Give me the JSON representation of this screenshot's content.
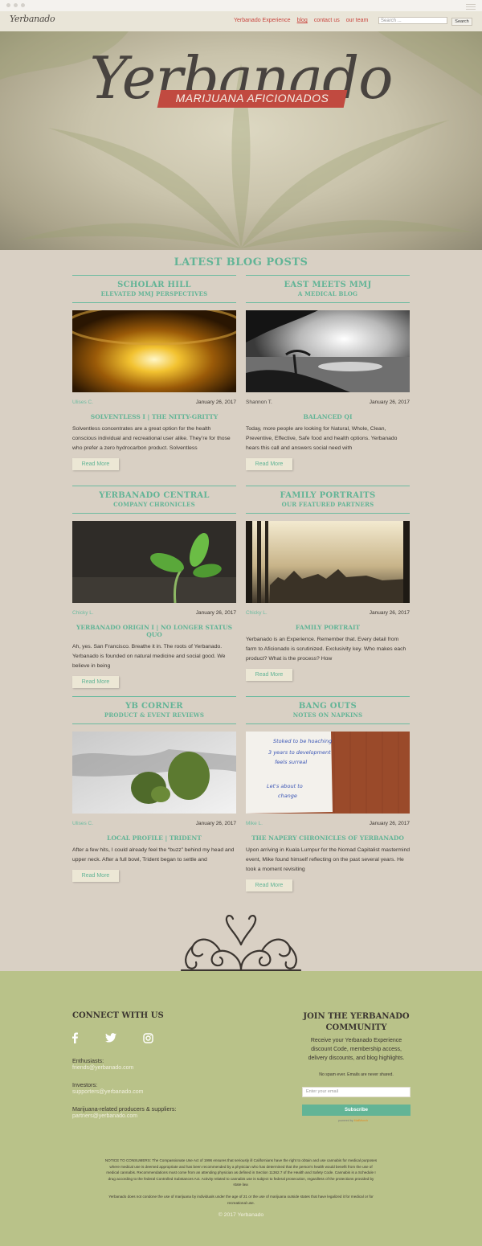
{
  "nav": {
    "logo": "Yerbanado",
    "links": [
      "Yerbanado Experience",
      "blog",
      "contact us",
      "our team"
    ],
    "active_link": "blog",
    "search_placeholder": "Search ...",
    "search_button": "Search"
  },
  "hero": {
    "title": "Yerbanado",
    "tagline": "MARIJUANA AFICIONADOS"
  },
  "latest": {
    "title": "LATEST BLOG POSTS"
  },
  "posts": [
    {
      "category": "SCHOLAR HILL",
      "subcategory": "ELEVATED MMJ PERSPECTIVES",
      "image": "amber-concentrate-jar",
      "author": "Ulises C.",
      "date": "January 26, 2017",
      "title": "SOLVENTLESS I | THE NITTY-GRITTY",
      "excerpt": "Solventless concentrates are a great option for the health conscious individual and recreational user alike. They’re for those who prefer a zero hydrocarbon product. Solventless",
      "read_more": "Read More"
    },
    {
      "category": "EAST MEETS MMJ",
      "subcategory": "A MEDICAL BLOG",
      "image": "lake-sunset-silhouette",
      "author": "Shannon T.",
      "date": "January 26, 2017",
      "title": "BALANCED QI",
      "excerpt": "Today, more people are looking for Natural, Whole, Clean, Preventive, Effective, Safe food and health options. Yerbanado hears this call and answers social need with",
      "read_more": "Read More"
    },
    {
      "category": "YERBANADO CENTRAL",
      "subcategory": "COMPANY CHRONICLES",
      "image": "seedling-sprout",
      "author": "Chicky L.",
      "date": "January 26, 2017",
      "title": "YERBANADO ORIGIN I | NO LONGER STATUS QUO",
      "excerpt": "Ah, yes. San Francisco. Breathe it in. The roots of Yerbanado. Yerbanado is founded on natural medicine and social good. We believe in being",
      "read_more": "Read More"
    },
    {
      "category": "FAMILY PORTRAITS",
      "subcategory": "OUR FEATURED PARTNERS",
      "image": "city-skyline-window",
      "author": "Chicky L.",
      "date": "January 26, 2017",
      "title": "FAMILY PORTRAIT",
      "excerpt": "Yerbanado is an Experience. Remember that. Every detail from farm to Aficionado is scrutinized. Exclusivity key. Who makes each product? What is the process? How",
      "read_more": "Read More"
    },
    {
      "category": "YB CORNER",
      "subcategory": "PRODUCT & EVENT REVIEWS",
      "image": "cannabis-buds",
      "author": "Ulises C.",
      "date": "January 26, 2017",
      "title": "LOCAL PROFILE | TRIDENT",
      "excerpt": "After a few hits, I could already feel the “buzz” behind my head and upper neck. After a full bowl, Trident began to settle and",
      "read_more": "Read More"
    },
    {
      "category": "BANG OUTS",
      "subcategory": "NOTES ON NAPKINS",
      "image": "handwritten-napkin",
      "author": "Mike L.",
      "date": "January 26, 2017",
      "title": "THE NAPERY CHRONICLES OF YERBANADO",
      "excerpt": "Upon arriving in Kuala Lumpur for the Nomad Capitalist mastermind event, Mike found himself reflecting on the past several years. He took a moment revisiting",
      "read_more": "Read More"
    }
  ],
  "napkin_lines": [
    "Stoked to be hoaching",
    "3 years to development",
    "feels surreal",
    "Let's about to",
    "change"
  ],
  "footer": {
    "connect_title": "CONNECT WITH US",
    "social_icons": [
      "facebook-icon",
      "twitter-icon",
      "instagram-icon"
    ],
    "contacts": [
      {
        "label": "Enthusiasts:",
        "email": "friends@yerbanado.com"
      },
      {
        "label": "Investors:",
        "email": "supporters@yerbanado.com"
      },
      {
        "label": "Marijuana-related producers & suppliers:",
        "email": "partners@yerbanado.com"
      }
    ],
    "join_title": "JOIN THE YERBANADO COMMUNITY",
    "join_desc": "Receive your Yerbanado Experience discount Code, membership access, delivery discounts, and blog highlights.",
    "no_spam": "No spam ever. Emails are never shared.",
    "email_placeholder": "Enter your email",
    "subscribe": "Subscribe",
    "powered_by": "powered by",
    "powered_brand": "MailMunch",
    "notice": "NOTICE TO CONSUMERS: The Compassionate Use Act of 1996 ensures that seriously ill Californians have the right to obtain and use cannabis for medical purposes where medical use is deemed appropriate and has been recommended by a physician who has determined that the person's health would benefit from the use of medical cannabis. Recommendations must come from an attending physician as defined in Section 11362.7 of the Health and Safety Code. Cannabis is a Schedule I drug according to the federal Controlled Substances Act. Activity related to cannabis use is subject to federal prosecution, regardless of the protections provided by state law.",
    "notice2": "Yerbanado does not condone the use of marijuana by individuals under the age of 21 or the use of marijuana outside states that have legalized it for medical or for recreational use.",
    "copyright": "© 2017 Yerbanado"
  },
  "colors": {
    "accent": "#62b496",
    "nav_link": "#c9453e",
    "footer_bg": "#b9c289",
    "page_bg": "#d9d0c4"
  }
}
